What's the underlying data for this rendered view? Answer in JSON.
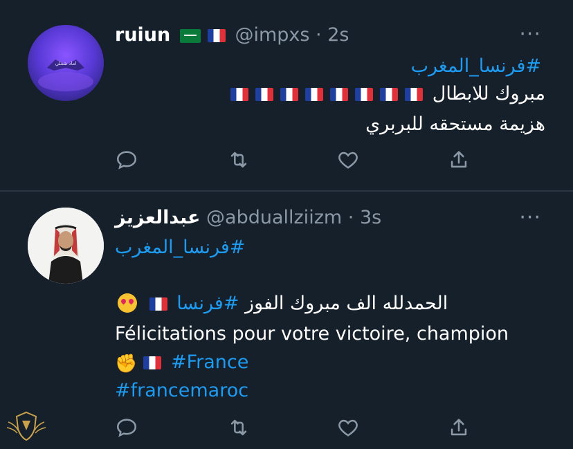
{
  "tweets": [
    {
      "name": "ruiun",
      "handle": "@impxs",
      "separator": "·",
      "time": "2s",
      "more": "···",
      "avatar_text": "اماد شغلي",
      "hashtag": "#فرنسا_المغرب",
      "line1_text": "مبروك للابطال",
      "line1_flag_count": 8,
      "line2_text": "هزيمة مستحقه للبربري",
      "flags": [
        "saudi-arabia",
        "france"
      ]
    },
    {
      "name": "عبدالعزيز",
      "handle": "@abduallziizm",
      "separator": "·",
      "time": "3s",
      "more": "···",
      "hashtag": "#فرنسا_المغرب",
      "ar_line": "الحمدلله الف مبروك الفوز",
      "ar_hashtag": "#فرنسا",
      "fr_line": "Félicitations pour votre victoire, champion",
      "fr_hashtag": "#France",
      "tag2": "#francemaroc"
    }
  ],
  "actions": [
    "reply-icon",
    "retweet-icon",
    "like-icon",
    "share-icon"
  ],
  "colors": {
    "background": "#15202b",
    "link": "#1d9bf0",
    "muted": "#8b98a5",
    "text": "#ffffff"
  }
}
